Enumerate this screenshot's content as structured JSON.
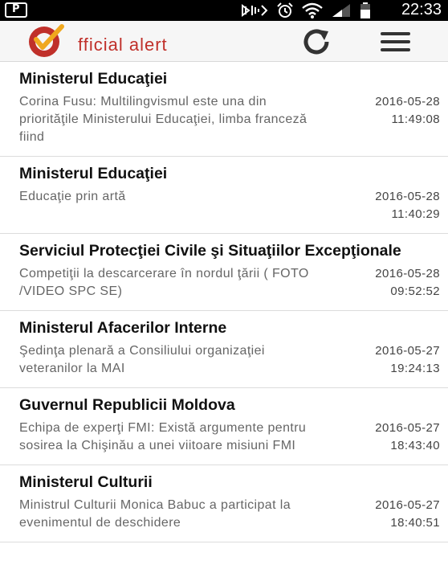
{
  "status_bar": {
    "time": "22:33",
    "icons": [
      "notification-icon",
      "signal-icon",
      "alarm-icon",
      "wifi-icon",
      "cell-signal-icon",
      "battery-icon"
    ]
  },
  "app_bar": {
    "logo_text": "fficial alert",
    "brand_color": "#c0302a"
  },
  "news": [
    {
      "source": "Ministerul Educaţiei",
      "text": "Corina Fusu: Multilingvismul este una din priorităţile Ministerului Educaţiei, limba franceză fiind",
      "date": "2016-05-28",
      "time": "11:49:08"
    },
    {
      "source": "Ministerul Educaţiei",
      "text": "Educaţie prin artă",
      "date": "2016-05-28",
      "time": "11:40:29"
    },
    {
      "source": "Serviciul Protecţiei Civile şi Situaţiilor Excepţionale",
      "text": "Competiţii la descarcerare în nordul ţării ( FOTO /VIDEO SPC SE)",
      "date": "2016-05-28",
      "time": "09:52:52"
    },
    {
      "source": "Ministerul Afacerilor Interne",
      "text": "Şedinţa plenară a Consiliului organizaţiei veteranilor la MAI",
      "date": "2016-05-27",
      "time": "19:24:13"
    },
    {
      "source": "Guvernul Republicii Moldova",
      "text": "Echipa de experţi FMI: Există argumente pentru sosirea la Chişinău a unei viitoare misiuni FMI",
      "date": "2016-05-27",
      "time": "18:43:40"
    },
    {
      "source": "Ministerul Culturii",
      "text": "Ministrul Culturii Monica Babuc a participat la evenimentul de deschidere",
      "date": "2016-05-27",
      "time": "18:40:51"
    }
  ]
}
